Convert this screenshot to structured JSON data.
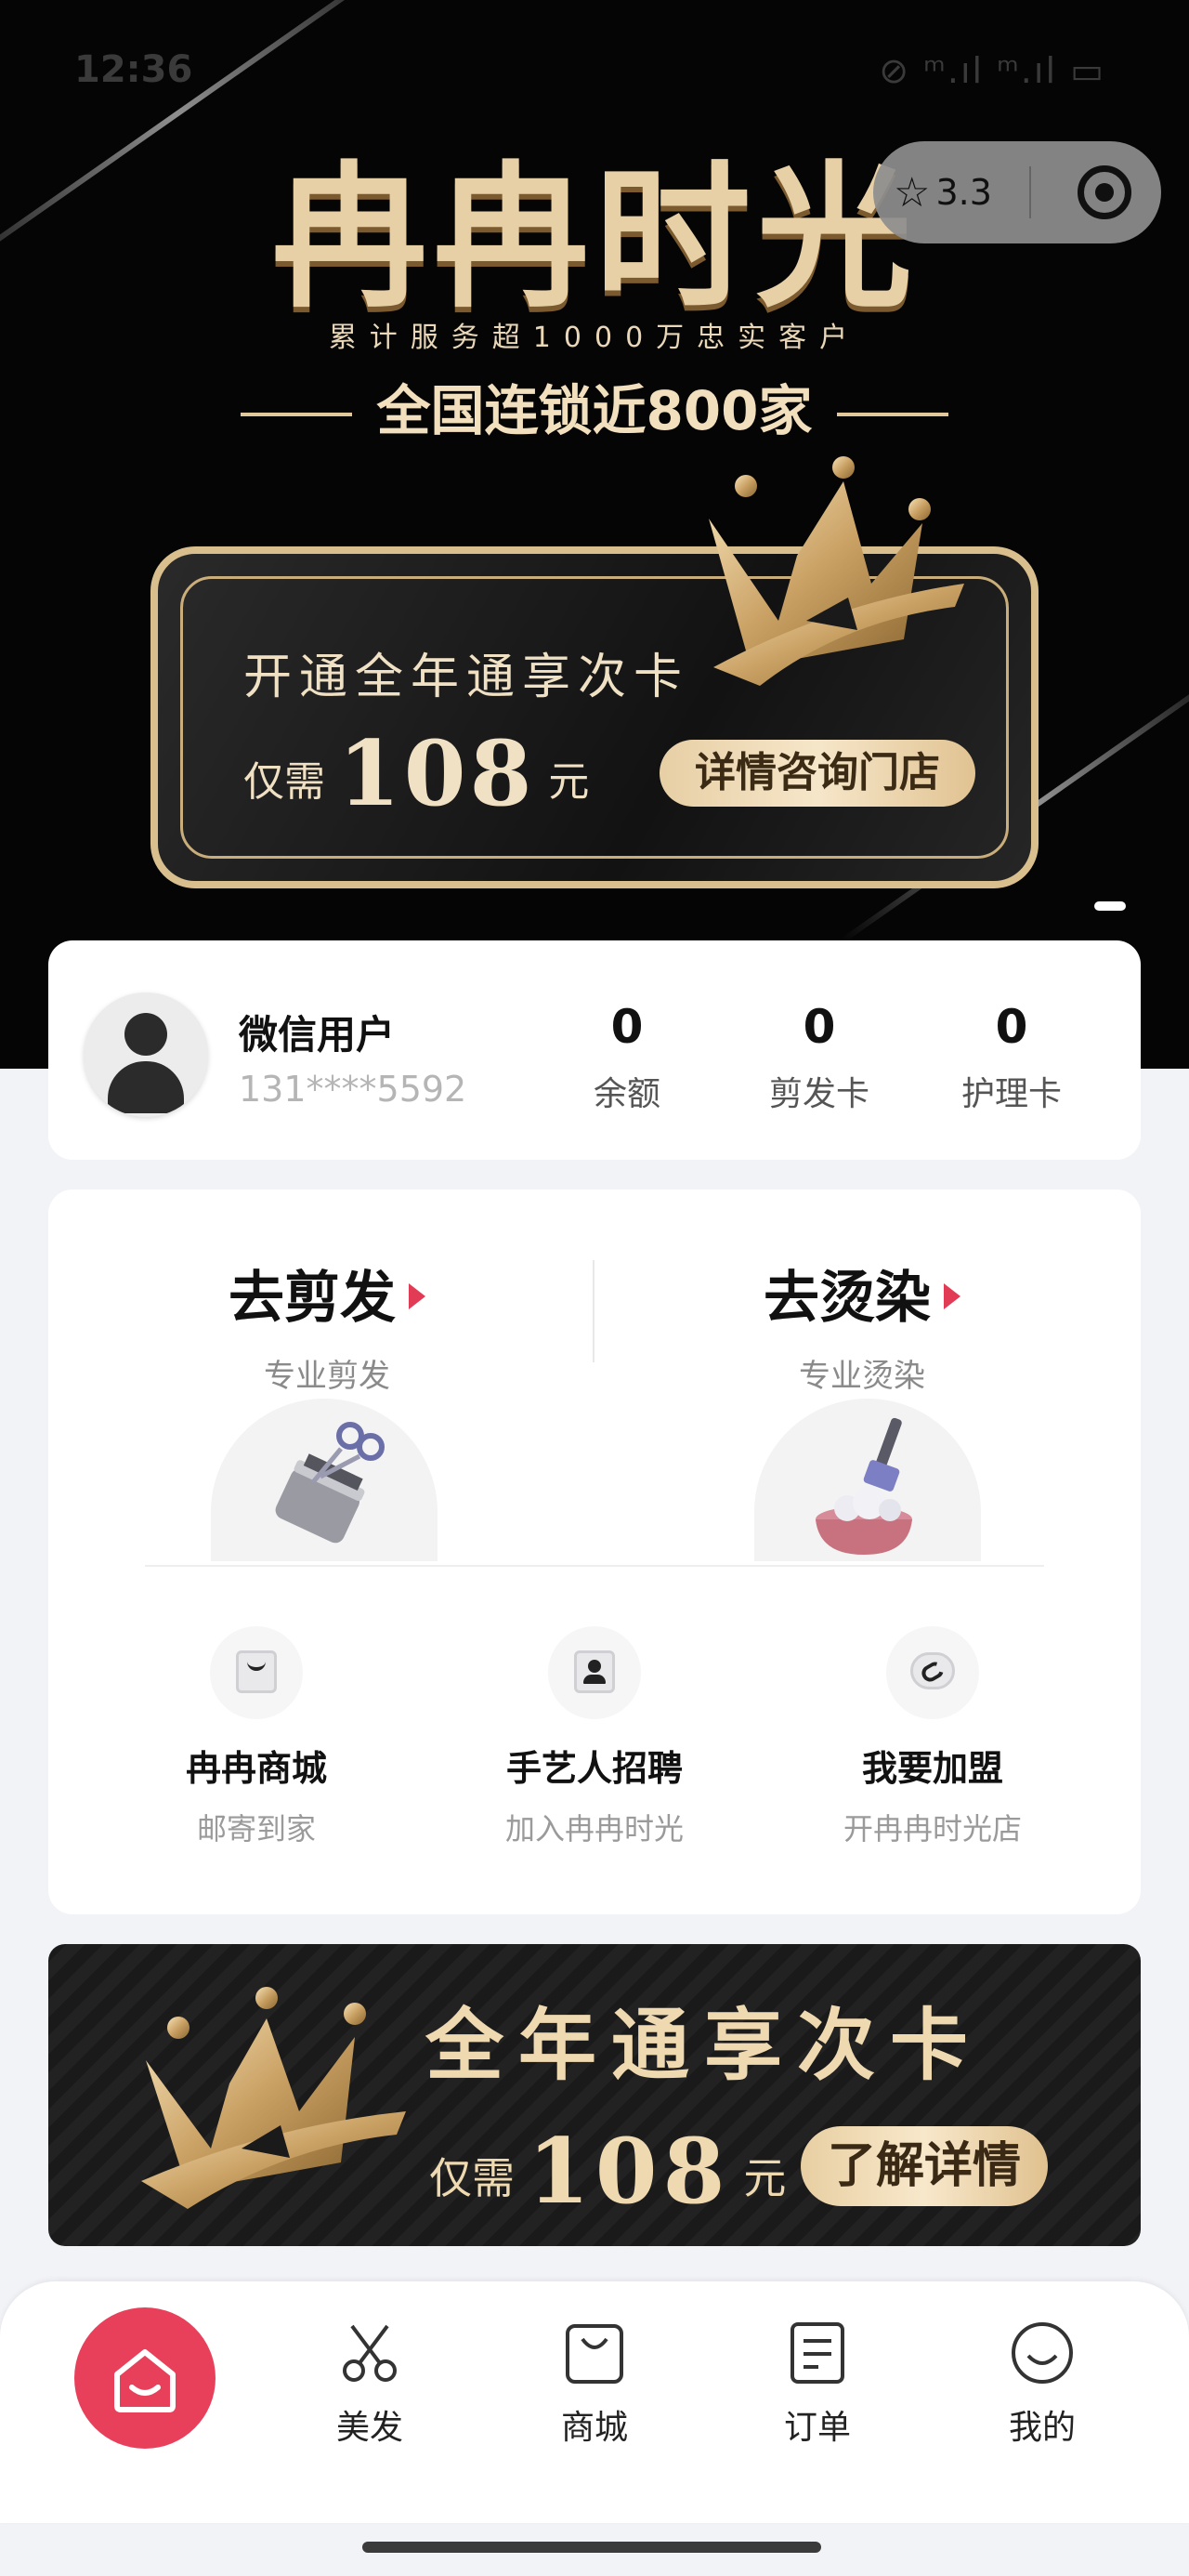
{
  "status_bar": {
    "time": "12:36",
    "indicators": "⊘ ᵐ.ıl ᵐ.ıl ▭"
  },
  "hero": {
    "brand": "冉冉时光",
    "tagline": "累计服务超1000万忠实客户",
    "chain": "全国连锁近800家",
    "card_title": "开通全年通享次卡",
    "price_prefix": "仅需",
    "price_value": "108",
    "price_unit": "元",
    "card_button": "详情咨询门店"
  },
  "capsule": {
    "rating": "3.3"
  },
  "user": {
    "name": "微信用户",
    "phone": "131****5592",
    "stats": [
      {
        "value": "0",
        "label": "余额"
      },
      {
        "value": "0",
        "label": "剪发卡"
      },
      {
        "value": "0",
        "label": "护理卡"
      }
    ]
  },
  "services": {
    "main": [
      {
        "title": "去剪发",
        "subtitle": "专业剪发"
      },
      {
        "title": "去烫染",
        "subtitle": "专业烫染"
      }
    ],
    "sub": [
      {
        "title": "冉冉商城",
        "subtitle": "邮寄到家"
      },
      {
        "title": "手艺人招聘",
        "subtitle": "加入冉冉时光"
      },
      {
        "title": "我要加盟",
        "subtitle": "开冉冉时光店"
      }
    ]
  },
  "banner": {
    "title": "全年通享次卡",
    "price_prefix": "仅需",
    "price_value": "108",
    "price_unit": "元",
    "button": "了解详情"
  },
  "tabbar": {
    "tabs": [
      "美发",
      "商城",
      "订单",
      "我的"
    ]
  },
  "colors": {
    "accent": "#e8405a",
    "gold": "#e8d0a6",
    "hero_bg": "#050505"
  }
}
